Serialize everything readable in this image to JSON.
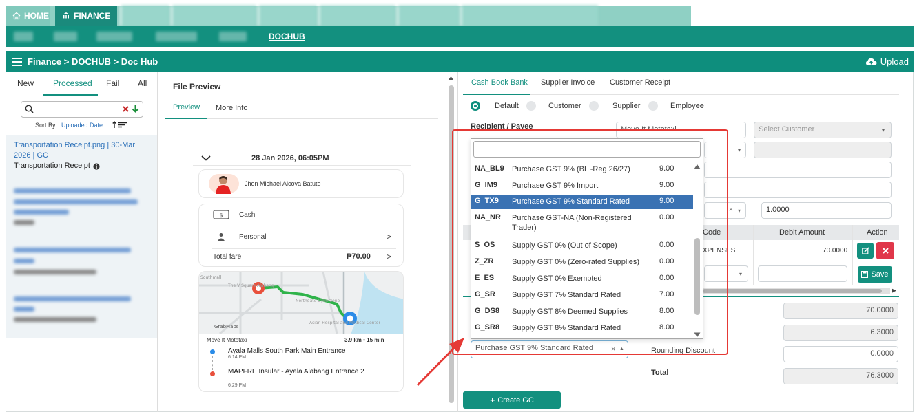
{
  "top_nav": {
    "home": "HOME",
    "finance": "FINANCE"
  },
  "sub_nav": {
    "active": "DOCHUB"
  },
  "header": {
    "breadcrumb": "Finance > DOCHUB > Doc Hub",
    "upload": "Upload"
  },
  "left": {
    "tabs": [
      "New",
      "Processed",
      "Fail",
      "All"
    ],
    "sort_prefix": "Sort By :",
    "sort_value": "Uploaded Date",
    "item": {
      "title": "Transportation Receipt.png | 30-Mar 2026 | GC",
      "subtitle": "Transportation Receipt"
    }
  },
  "preview": {
    "title": "File Preview",
    "tabs": [
      "Preview",
      "More Info"
    ],
    "receipt": {
      "date": "28 Jan 2026, 06:05PM",
      "driver": "Jhon Michael Alcova Batuto",
      "payment": "Cash",
      "profile": "Personal",
      "total_label": "Total fare",
      "total_value": "₱70.00",
      "map_label": "GrabMaps",
      "map_place_1": "Northgate Cyberzone",
      "map_place_2": "Asian Hospital and Medical Center",
      "map_place_3": "The V Square Alabang",
      "map_place_4": "Southmall",
      "service": "Move It Mototaxi",
      "trip": "3.9 km • 15 min",
      "pickup": "Ayala Malls South Park Main Entrance",
      "pickup_time": "6:14 PM",
      "dropoff": "MAPFRE Insular - Ayala Alabang Entrance 2",
      "dropoff_time": "6:29 PM"
    }
  },
  "form": {
    "tabs": [
      "Cash Book Bank",
      "Supplier Invoice",
      "Customer Receipt"
    ],
    "radios": [
      "Default",
      "Customer",
      "Supplier",
      "Employee"
    ],
    "recipient_label": "Recipient / Payee",
    "recipient_value": "Move It Mototaxi",
    "customer_placeholder": "Select Customer",
    "rate_value": "1.0000",
    "table_headers": [
      "Code",
      "Debit Amount",
      "Action"
    ],
    "row_code": "XPENSES",
    "row_amount": "70.0000",
    "save": "Save",
    "tax_selected": "Purchase GST 9% Standard Rated",
    "rounding_label": "Rounding Discount",
    "total_label": "Total",
    "totals": [
      "70.0000",
      "6.3000",
      "0.0000",
      "76.3000"
    ],
    "create_gc": "Create GC"
  },
  "dropdown_options": [
    {
      "code": "NA_BL9",
      "desc": "Purchase GST 9% (BL -Reg 26/27)",
      "rate": "9.00"
    },
    {
      "code": "G_IM9",
      "desc": "Purchase GST 9% Import",
      "rate": "9.00"
    },
    {
      "code": "G_TX9",
      "desc": "Purchase GST 9% Standard Rated",
      "rate": "9.00"
    },
    {
      "code": "NA_NR",
      "desc": "Purchase GST-NA (Non-Registered Trader)",
      "rate": "0.00"
    },
    {
      "code": "S_OS",
      "desc": "Supply GST 0% (Out of Scope)",
      "rate": "0.00"
    },
    {
      "code": "Z_ZR",
      "desc": "Supply GST 0% (Zero-rated Supplies)",
      "rate": "0.00"
    },
    {
      "code": "E_ES",
      "desc": "Supply GST 0% Exempted",
      "rate": "0.00"
    },
    {
      "code": "G_SR",
      "desc": "Supply GST 7% Standard Rated",
      "rate": "7.00"
    },
    {
      "code": "G_DS8",
      "desc": "Supply GST 8% Deemed Supplies",
      "rate": "8.00"
    },
    {
      "code": "G_SR8",
      "desc": "Supply GST 8% Standard Rated",
      "rate": "8.00"
    }
  ],
  "colors": {
    "brand": "#0e8e7d",
    "selected": "#3a72b3",
    "annotation": "#e53935",
    "link": "#2a6fb8"
  }
}
